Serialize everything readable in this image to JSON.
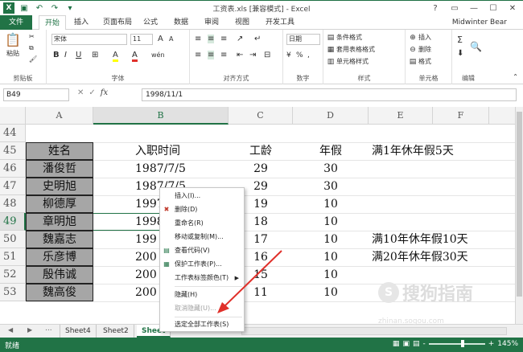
{
  "title_bar": {
    "title": "工资表.xls [兼容模式] - Excel",
    "quick_access": [
      "save-icon",
      "undo-icon",
      "redo-icon",
      "customize-icon"
    ]
  },
  "window_controls": {
    "help": "?",
    "restore": "▭",
    "minimize": "—",
    "maximize": "☐",
    "close": "✕"
  },
  "ribbon_tabs": [
    "文件",
    "开始",
    "插入",
    "页面布局",
    "公式",
    "数据",
    "审阅",
    "视图",
    "开发工具"
  ],
  "user": "Midwinter Bear",
  "ribbon": {
    "clipboard": {
      "label": "剪贴板",
      "paste": "粘贴"
    },
    "font": {
      "label": "字体",
      "font_name": "宋体",
      "font_size": "11",
      "bold": "B",
      "italic": "I",
      "underline": "U",
      "grow": "A",
      "shrink": "A",
      "fill": "A",
      "font_color": "A",
      "phonetic": "wén"
    },
    "alignment": {
      "label": "对齐方式"
    },
    "number": {
      "label": "数字",
      "format": "日期",
      "percent": "%",
      "comma": ","
    },
    "styles": {
      "label": "样式",
      "conditional": "条件格式",
      "table": "套用表格格式",
      "cell_styles": "单元格样式"
    },
    "cells": {
      "label": "单元格",
      "insert": "插入",
      "delete": "删除",
      "format": "格式"
    },
    "editing": {
      "label": "编辑",
      "sum": "Σ",
      "find": "♀"
    }
  },
  "formula_bar": {
    "name_box": "B49",
    "cancel": "✕",
    "enter": "✓",
    "fx": "fx",
    "value": "1998/11/1"
  },
  "columns": [
    "A",
    "B",
    "C",
    "D",
    "E",
    "F"
  ],
  "rows": [
    "44",
    "45",
    "46",
    "47",
    "48",
    "49",
    "50",
    "51",
    "52",
    "53"
  ],
  "cells": {
    "r45": {
      "a": "姓名",
      "b": "入职时间",
      "c": "工龄",
      "d": "年假",
      "e": "满1年休年假5天"
    },
    "r46": {
      "a": "潘俊哲",
      "b": "1987/7/5",
      "c": "29",
      "d": "30"
    },
    "r47": {
      "a": "史明旭",
      "b": "1987/7/5",
      "c": "29",
      "d": "30"
    },
    "r48": {
      "a": "柳德厚",
      "b": "1997",
      "c": "19",
      "d": "10"
    },
    "r49": {
      "a": "章明旭",
      "b": "1998",
      "c": "18",
      "d": "10"
    },
    "r50": {
      "a": "魏嘉志",
      "b": "199",
      "c": "17",
      "d": "10",
      "e": "满10年休年假10天"
    },
    "r51": {
      "a": "乐彦博",
      "b": "200",
      "c": "16",
      "d": "10",
      "e": "满20年休年假30天"
    },
    "r52": {
      "a": "殷伟诚",
      "b": "200",
      "c": "15",
      "d": "10"
    },
    "r53": {
      "a": "魏高俊",
      "b": "200",
      "c": "11",
      "d": "10"
    }
  },
  "context_menu": [
    {
      "label": "插入(I)...",
      "icon": ""
    },
    {
      "label": "删除(D)",
      "icon": "delete-sheet-icon"
    },
    {
      "label": "重命名(R)",
      "icon": ""
    },
    {
      "label": "移动或复制(M)...",
      "icon": ""
    },
    {
      "label": "查看代码(V)",
      "icon": "view-code-icon"
    },
    {
      "label": "保护工作表(P)...",
      "icon": "protect-sheet-icon"
    },
    {
      "label": "工作表标签颜色(T)",
      "icon": "",
      "submenu": true
    },
    {
      "label": "隐藏(H)",
      "icon": ""
    },
    {
      "label": "取消隐藏(U)...",
      "icon": "",
      "disabled": true
    },
    {
      "label": "选定全部工作表(S)",
      "icon": ""
    }
  ],
  "sheet_tabs": [
    "Sheet4",
    "Sheet2",
    "Sheet"
  ],
  "sheet_nav": {
    "prev": "◀",
    "next": "▶",
    "more": "..."
  },
  "status": {
    "ready": "就绪",
    "zoom": "145%",
    "zoom_minus": "-",
    "zoom_plus": "+"
  },
  "watermark": {
    "text": "搜狗指南",
    "url": "zhinan.sogou.com"
  },
  "colors": {
    "excel_green": "#217346",
    "name_cell_fill": "#a6a6a6",
    "arrow": "#e0302a"
  }
}
